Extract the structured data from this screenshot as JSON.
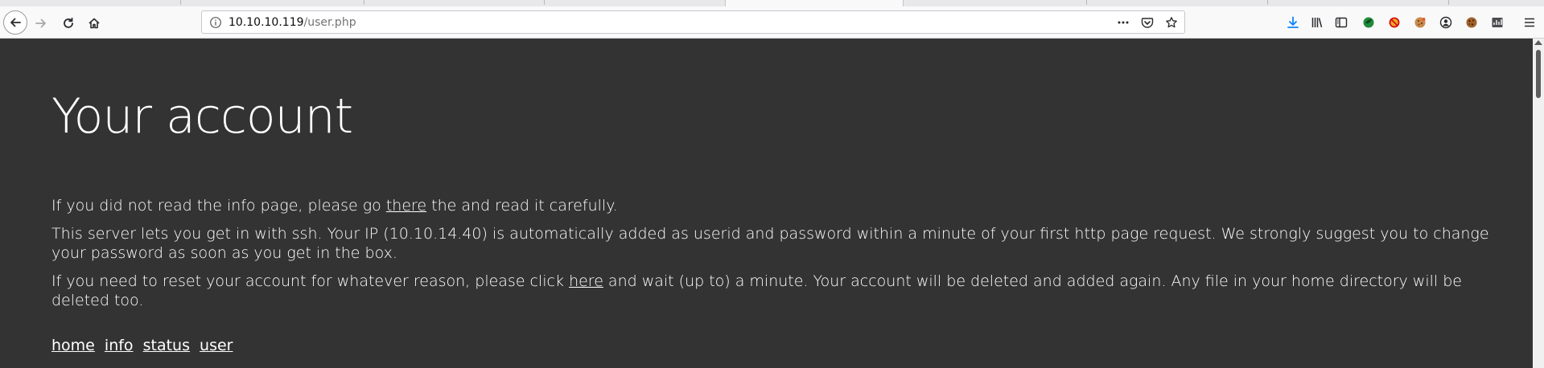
{
  "browser": {
    "url_host": "10.10.10.119",
    "url_path": "/user.php"
  },
  "colors": {
    "page_background": "#333333",
    "page_text": "#ffffff",
    "download_icon": "#0a84ff"
  },
  "toolbar_icons": [
    "downloads-icon",
    "library-icon",
    "sidebar-icon",
    "extension-green-icon",
    "extension-blocked-icon",
    "cookie-icon",
    "account-icon",
    "cookie-editor-icon",
    "extension-chart-icon",
    "menu-icon"
  ],
  "page": {
    "title": "Your account",
    "para1": {
      "before": "If you did not read the info page, please go ",
      "link": "there",
      "after": " the and read it carefully."
    },
    "para2": "This server lets you get in with ssh. Your IP (10.10.14.40) is automatically added as userid and password within a minute of your first http page request. We strongly suggest you to change your password as soon as you get in the box.",
    "para3": {
      "before": "If you need to reset your account for whatever reason, please click ",
      "link": "here",
      "after": " and wait (up to) a minute. Your account will be deleted and added again. Any file in your home directory will be deleted too."
    },
    "nav": [
      "home",
      "info",
      "status",
      "user"
    ]
  }
}
